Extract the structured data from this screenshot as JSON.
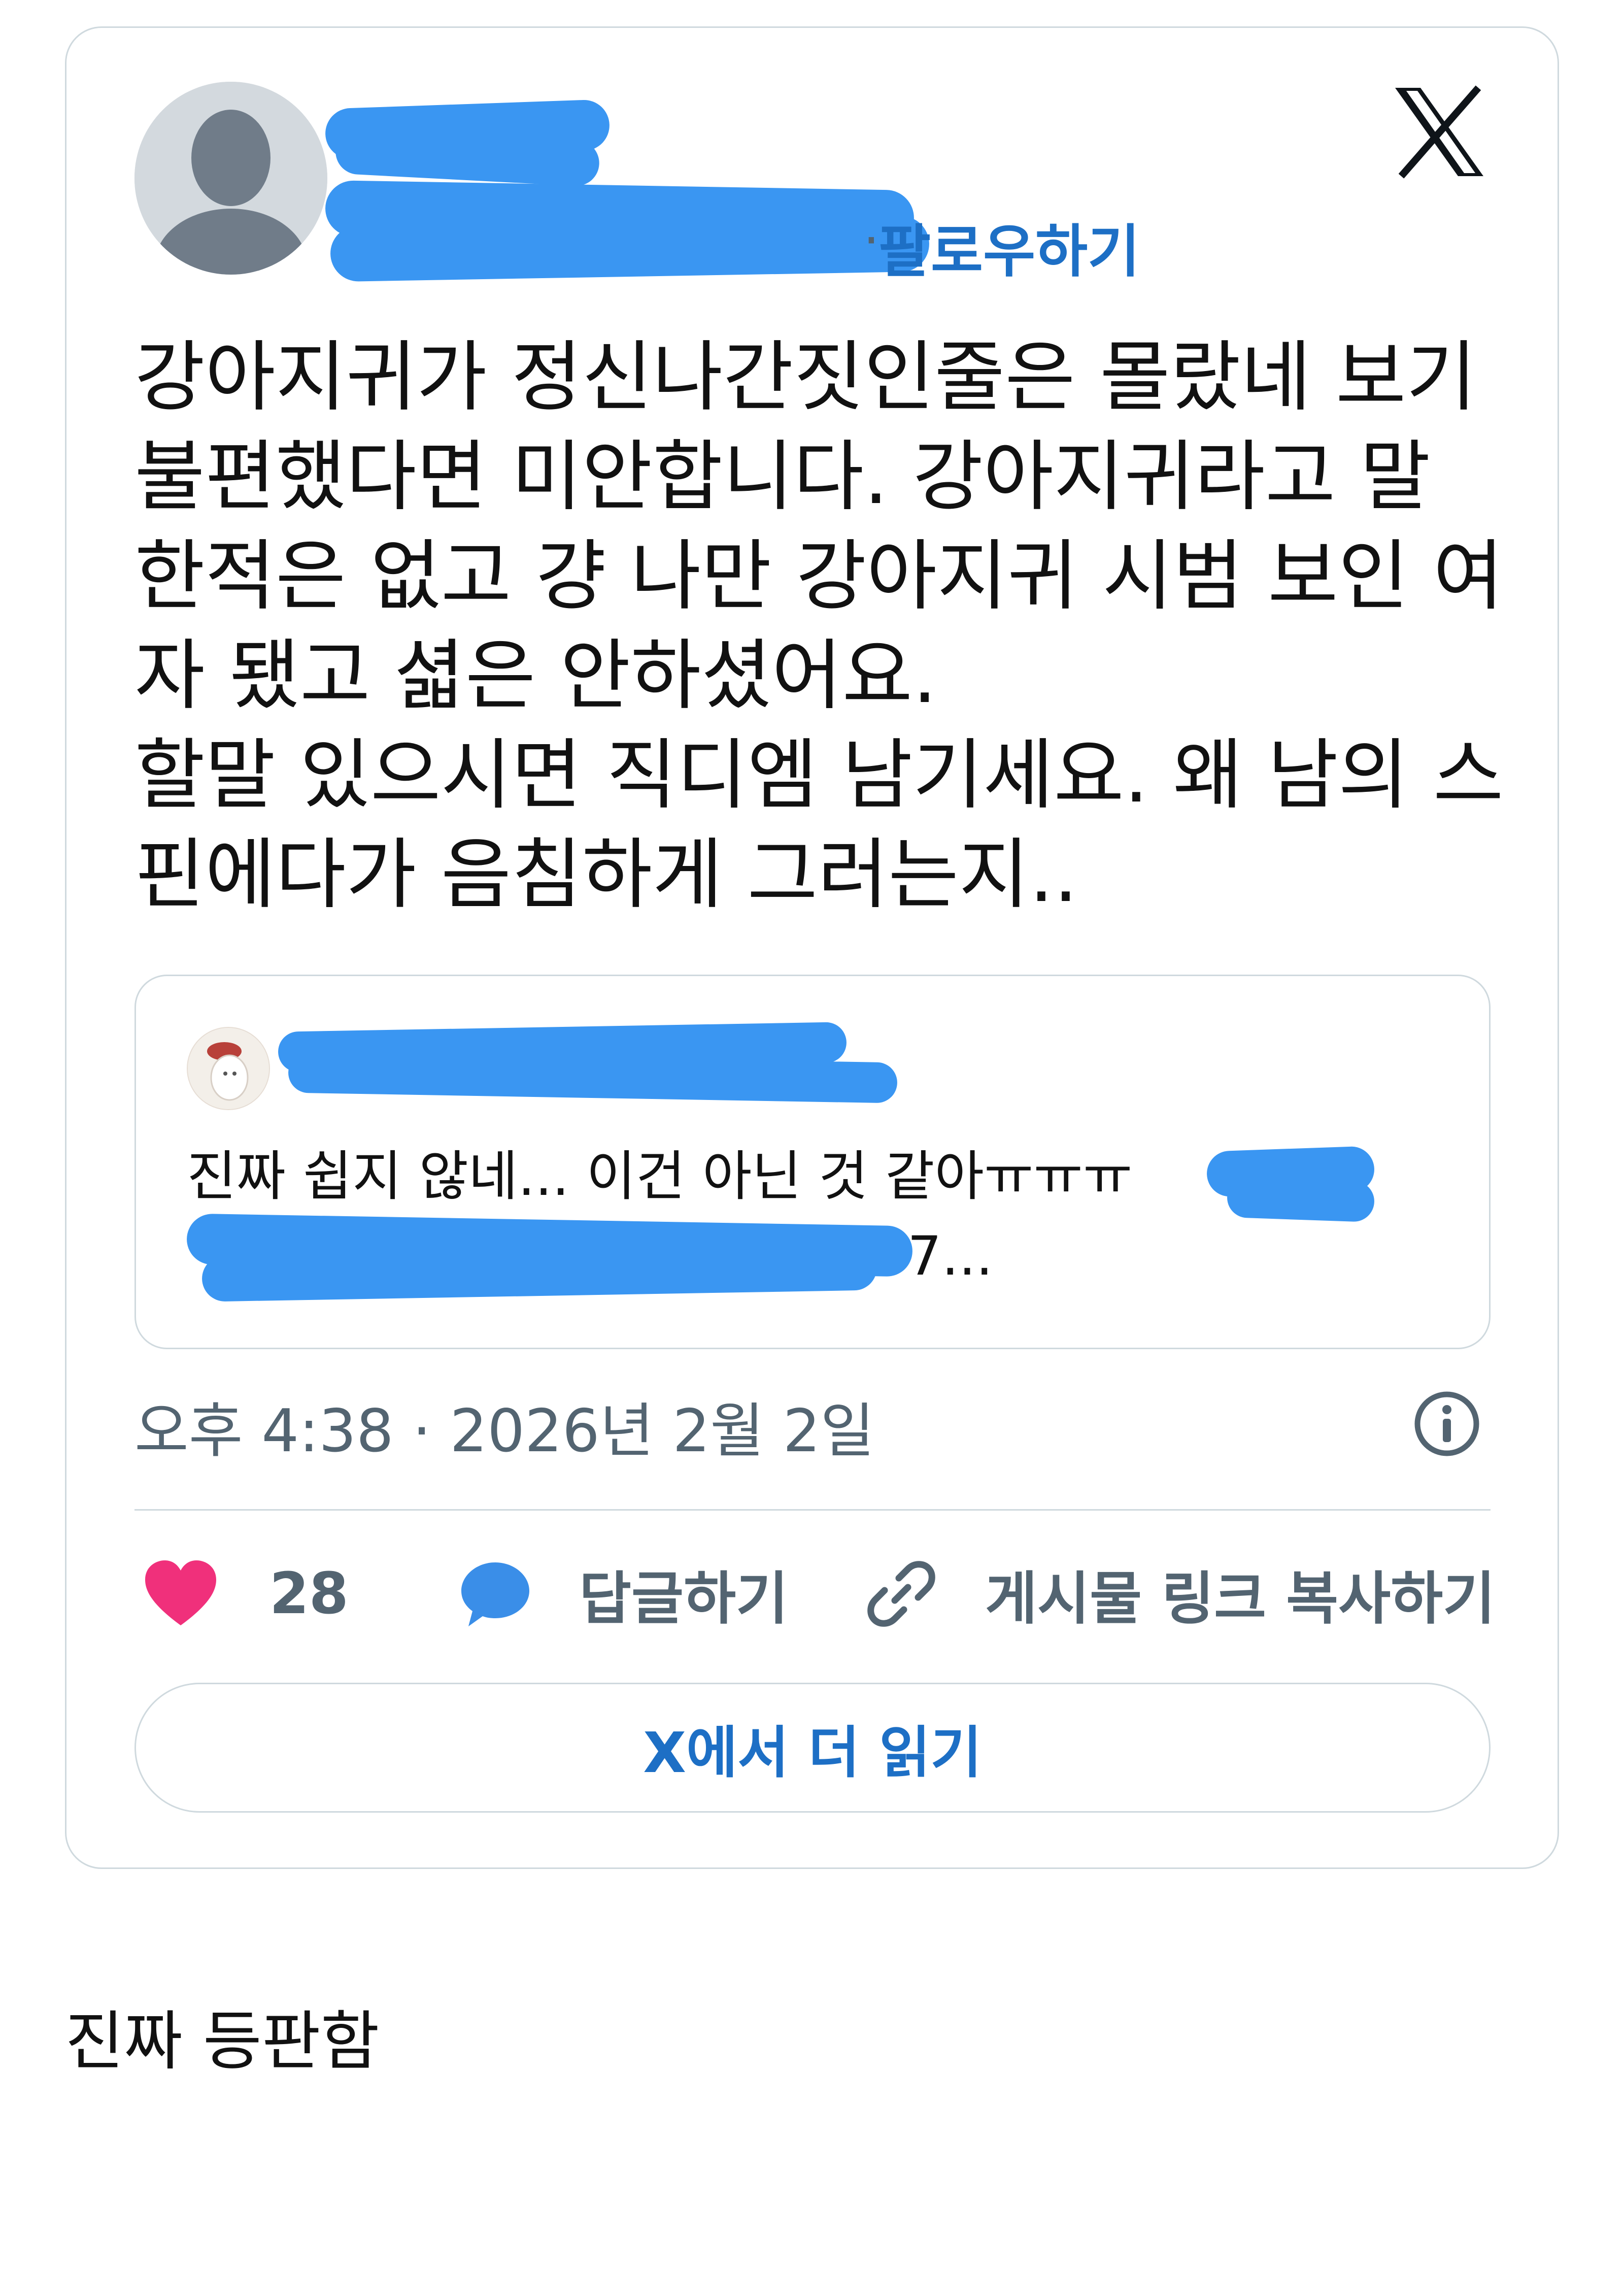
{
  "tweet": {
    "follow_label": "팔로우하기",
    "follow_separator": "·",
    "text": "강아지귀가 정신나간짓인줄은 몰랐네 보기\n불편했다면 미안합니다. 강아지귀라고 말\n한적은 없고 걍 나만 강아지귀 시범 보인 여\n자 됐고 셟은 안하셨어요.\n할말 있으시면 직디엠 남기세요. 왜 남의 스\n핀에다가 음침하게 그러는지..",
    "timestamp": "오후 4:38 · 2026년 2월 2일"
  },
  "quote": {
    "text": "진짜 쉽지 않네... 이건 아닌 것 같아ㅠㅠㅠ",
    "ellipsis": "7..."
  },
  "actions": {
    "like_count": "28",
    "reply_label": "답글하기",
    "copy_link_label": "게시물 링크 복사하기"
  },
  "read_more_label": "X에서 더 읽기",
  "caption": "진짜 등판함",
  "icons": {
    "logo": "x-logo-icon",
    "info": "info-icon",
    "like": "heart-icon",
    "reply": "speech-bubble-icon",
    "link": "link-icon"
  },
  "colors": {
    "accent": "#1d6fc5",
    "heart": "#f0307b",
    "reply_bubble": "#3a8ee8",
    "redaction": "#3a96f2",
    "border": "#cfd9de",
    "muted_text": "#536471"
  }
}
